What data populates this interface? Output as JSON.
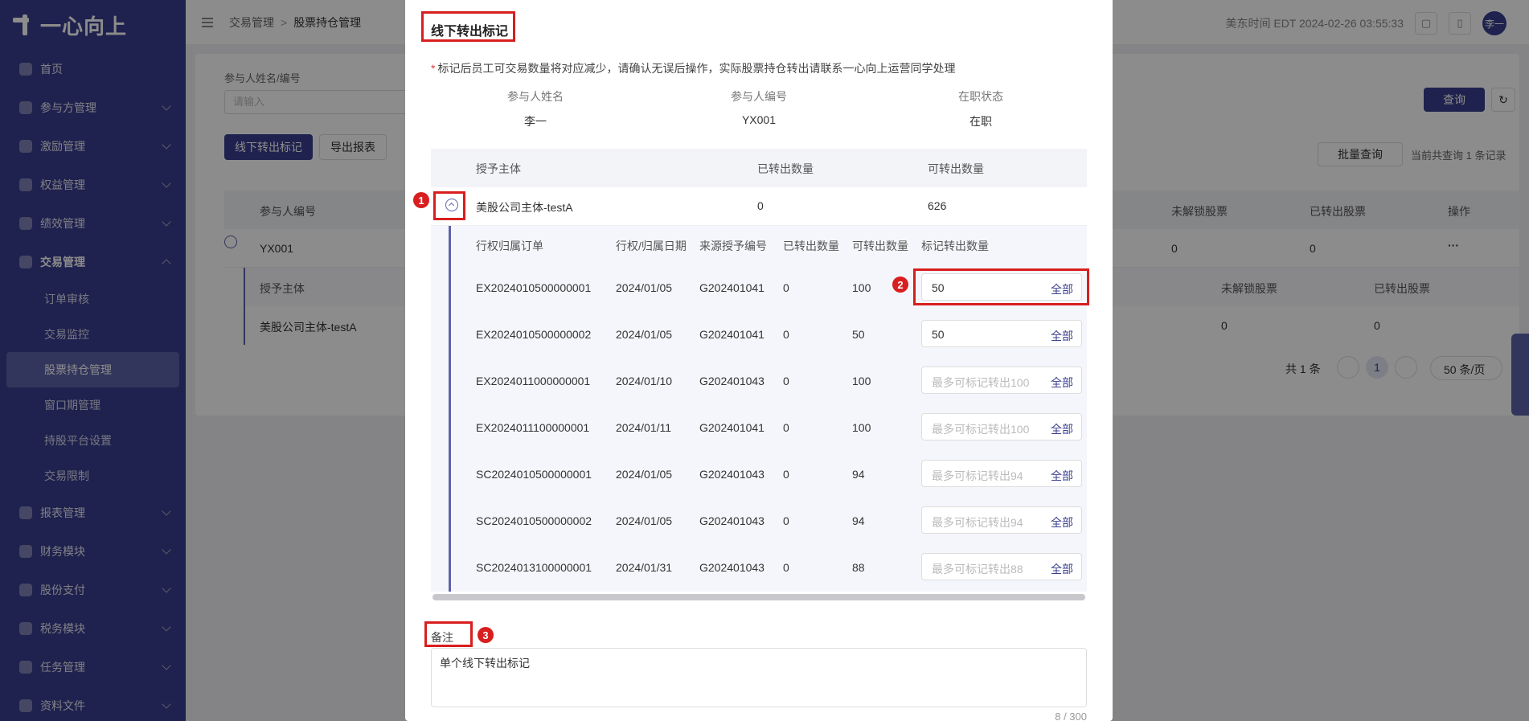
{
  "app": {
    "name": "一心向上"
  },
  "sidebar": {
    "items": [
      {
        "label": "首页"
      },
      {
        "label": "参与方管理"
      },
      {
        "label": "激励管理"
      },
      {
        "label": "权益管理"
      },
      {
        "label": "绩效管理"
      },
      {
        "label": "交易管理"
      },
      {
        "label": "报表管理"
      },
      {
        "label": "财务模块"
      },
      {
        "label": "股份支付"
      },
      {
        "label": "税务模块"
      },
      {
        "label": "任务管理"
      },
      {
        "label": "资料文件"
      }
    ],
    "sub_items": [
      {
        "label": "订单审核"
      },
      {
        "label": "交易监控"
      },
      {
        "label": "股票持仓管理"
      },
      {
        "label": "窗口期管理"
      },
      {
        "label": "持股平台设置"
      },
      {
        "label": "交易限制"
      }
    ]
  },
  "header": {
    "breadcrumb": [
      "交易管理",
      "股票持仓管理"
    ],
    "timezone_text": "美东时间 EDT 2024-02-26 03:55:33",
    "avatar_text": "李一"
  },
  "page": {
    "filter_label": "参与人姓名/编号",
    "filter_placeholder": "请输入",
    "btn_offline_mark": "线下转出标记",
    "btn_export": "导出报表",
    "btn_query": "查询",
    "btn_batch_query": "批量查询",
    "record_summary": "当前共查询 1 条记录",
    "table_headers": [
      "参与人编号",
      "未解锁股票",
      "已转出股票",
      "操作"
    ],
    "row": {
      "id": "YX001",
      "locked": "0",
      "transferred": "0",
      "more": "···"
    },
    "sub_headers": [
      "授予主体",
      "未解锁股票",
      "已转出股票"
    ],
    "sub_row": {
      "entity": "美股公司主体-testA",
      "locked": "0",
      "transferred": "0"
    },
    "pagination": {
      "total": "共 1 条",
      "current": "1",
      "page_size": "50 条/页"
    }
  },
  "modal": {
    "title": "线下转出标记",
    "notice": "标记后员工可交易数量将对应减少，请确认无误后操作，实际股票持仓转出请联系一心向上运营同学处理",
    "info_labels": [
      "参与人姓名",
      "参与人编号",
      "在职状态"
    ],
    "info_values": [
      "李一",
      "YX001",
      "在职"
    ],
    "grant_headers": [
      "授予主体",
      "已转出数量",
      "可转出数量"
    ],
    "grant_row": {
      "entity": "美股公司主体-testA",
      "transferred": "0",
      "available": "626"
    },
    "sub_headers": [
      "行权归属订单",
      "行权/归属日期",
      "来源授予编号",
      "已转出数量",
      "可转出数量",
      "标记转出数量"
    ],
    "all_label": "全部",
    "orders": [
      {
        "order": "EX2024010500000001",
        "date": "2024/01/05",
        "grant": "G202401041",
        "transferred": "0",
        "available": "100",
        "value": "50",
        "placeholder": ""
      },
      {
        "order": "EX2024010500000002",
        "date": "2024/01/05",
        "grant": "G202401041",
        "transferred": "0",
        "available": "50",
        "value": "50",
        "placeholder": ""
      },
      {
        "order": "EX2024011000000001",
        "date": "2024/01/10",
        "grant": "G202401043",
        "transferred": "0",
        "available": "100",
        "value": "",
        "placeholder": "最多可标记转出100"
      },
      {
        "order": "EX2024011100000001",
        "date": "2024/01/11",
        "grant": "G202401041",
        "transferred": "0",
        "available": "100",
        "value": "",
        "placeholder": "最多可标记转出100"
      },
      {
        "order": "SC2024010500000001",
        "date": "2024/01/05",
        "grant": "G202401043",
        "transferred": "0",
        "available": "94",
        "value": "",
        "placeholder": "最多可标记转出94"
      },
      {
        "order": "SC2024010500000002",
        "date": "2024/01/05",
        "grant": "G202401043",
        "transferred": "0",
        "available": "94",
        "value": "",
        "placeholder": "最多可标记转出94"
      },
      {
        "order": "SC2024013100000001",
        "date": "2024/01/31",
        "grant": "G202401043",
        "transferred": "0",
        "available": "88",
        "value": "",
        "placeholder": "最多可标记转出88"
      }
    ],
    "remark_label": "备注",
    "remark_text": "单个线下转出标记",
    "remark_count": "8 / 300",
    "annotations": [
      "1",
      "2",
      "3"
    ]
  },
  "colors": {
    "brand": "#3a3f8f",
    "highlight": "#d81e1e",
    "sidebar_active": "#5e63a8"
  }
}
